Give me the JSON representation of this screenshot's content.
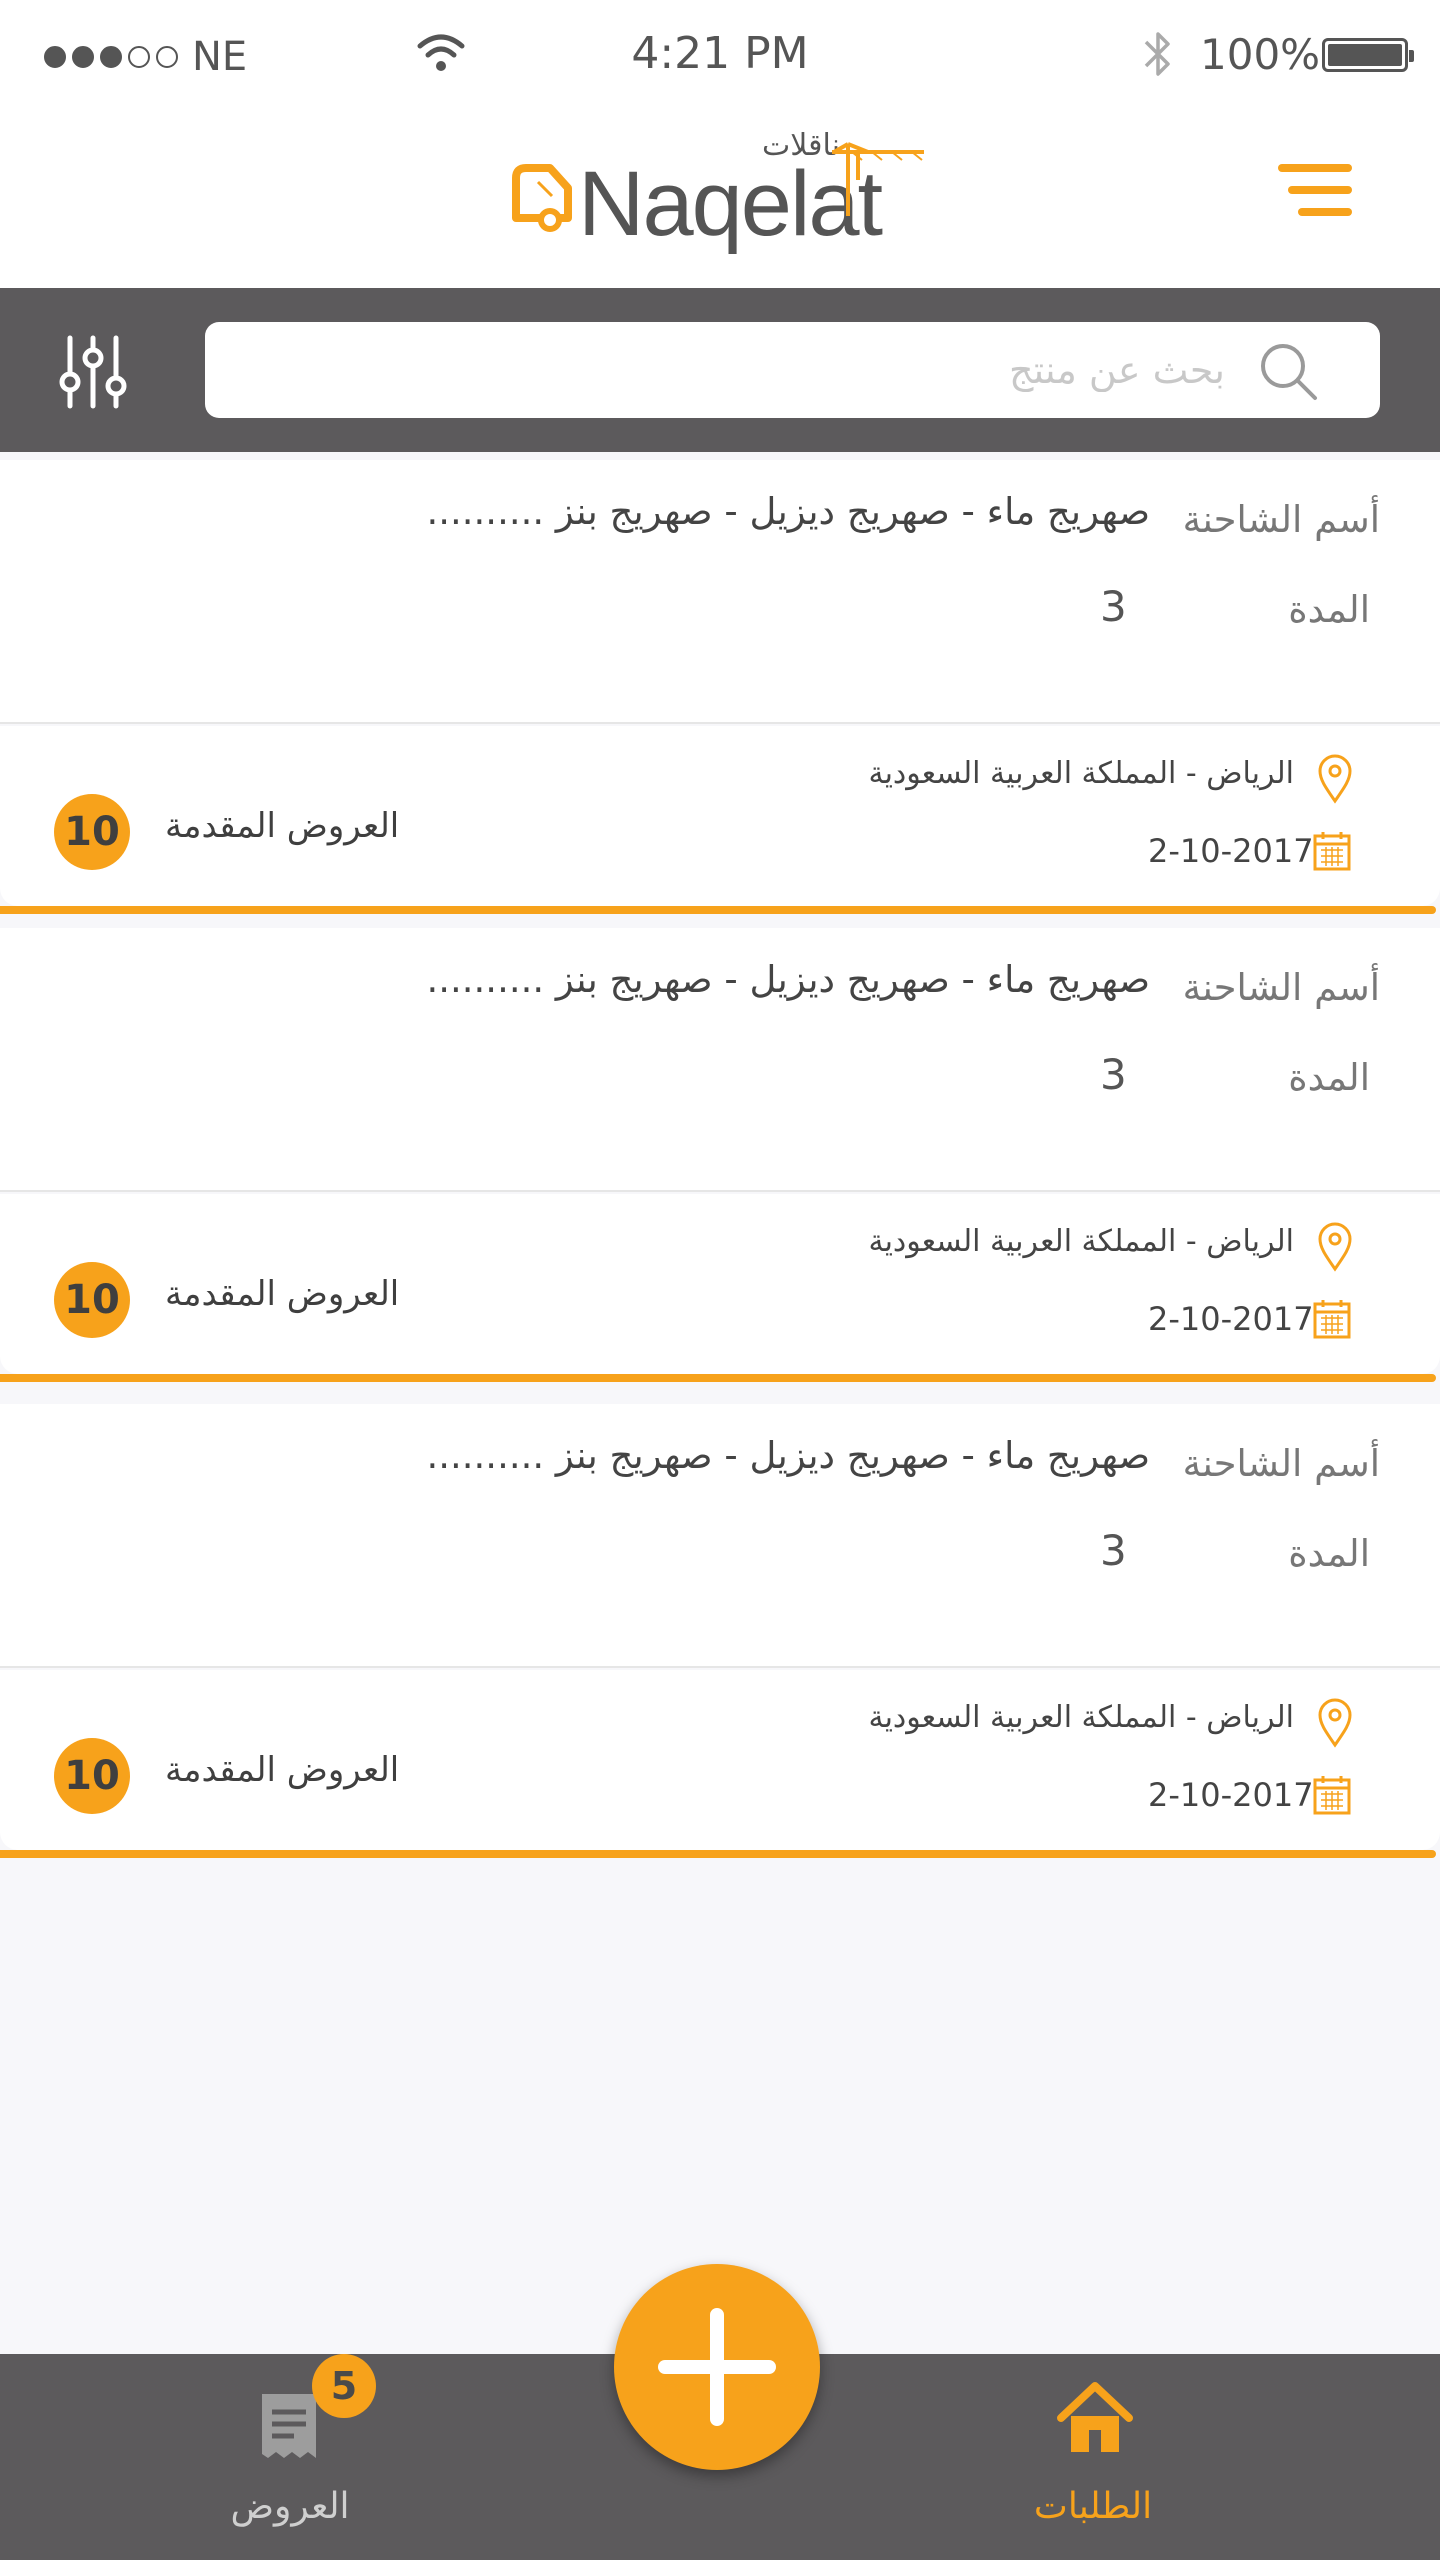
{
  "status_bar": {
    "carrier": "NE",
    "time": "4:21 PM",
    "battery": "100%"
  },
  "header": {
    "logo_latin": "Naqelat",
    "logo_arabic": "ناقلات"
  },
  "search": {
    "placeholder": "بحث عن منتج"
  },
  "cards": [
    {
      "truck_label": "أسم الشاحنة",
      "truck_value": "صهريج ماء - صهريج ديزيل - صهريج بنز ..........",
      "duration_label": "المدة",
      "duration_value": "3",
      "location": "الرياض - المملكة العربية السعودية",
      "date": "2-10-2017",
      "offers_count": "10",
      "offers_label": "العروض المقدمة"
    },
    {
      "truck_label": "أسم الشاحنة",
      "truck_value": "صهريج ماء - صهريج ديزيل - صهريج بنز ..........",
      "duration_label": "المدة",
      "duration_value": "3",
      "location": "الرياض - المملكة العربية السعودية",
      "date": "2-10-2017",
      "offers_count": "10",
      "offers_label": "العروض المقدمة"
    },
    {
      "truck_label": "أسم الشاحنة",
      "truck_value": "صهريج ماء - صهريج ديزيل - صهريج بنز ..........",
      "duration_label": "المدة",
      "duration_value": "3",
      "location": "الرياض - المملكة العربية السعودية",
      "date": "2-10-2017",
      "offers_count": "10",
      "offers_label": "العروض المقدمة"
    }
  ],
  "bottom_nav": {
    "offers_label": "العروض",
    "offers_badge": "5",
    "requests_label": "الطلبات",
    "fab_icon": "plus-icon"
  },
  "colors": {
    "accent": "#f7a21b",
    "bar": "#5c5a5c",
    "background": "#f7f7fa"
  }
}
